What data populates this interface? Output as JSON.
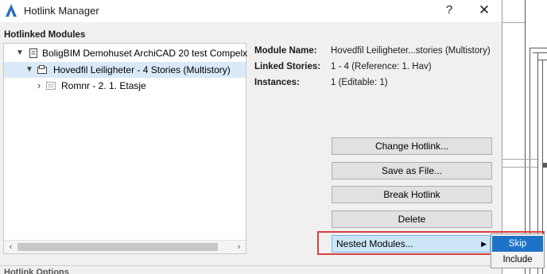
{
  "window": {
    "title": "Hotlink Manager",
    "help_glyph": "?",
    "close_glyph": "✕"
  },
  "section": {
    "title": "Hotlinked Modules"
  },
  "tree": {
    "items": [
      {
        "label": "BoligBIM Demohuset ArchiCAD 20 test Compelx",
        "expander": "▼",
        "icon": "project-file-icon",
        "selected": false
      },
      {
        "label": "Hovedfil Leiligheter - 4 Stories (Multistory)",
        "expander": "▼",
        "icon": "hotlink-module-icon",
        "selected": true
      },
      {
        "label": "Romnr - 2. 1. Etasje",
        "expander": "›",
        "icon": "hotlink-module-dashed-icon",
        "selected": false
      }
    ],
    "scroll_left": "‹",
    "scroll_right": "›"
  },
  "info": {
    "module_name_label": "Module Name:",
    "module_name_value": "Hovedfil Leiligheter...stories (Multistory)",
    "linked_stories_label": "Linked Stories:",
    "linked_stories_value": "1 - 4 (Reference: 1. Hav)",
    "instances_label": "Instances:",
    "instances_value": "1 (Editable: 1)"
  },
  "buttons": {
    "change_hotlink": "Change Hotlink...",
    "save_as_file": "Save as File...",
    "break_hotlink": "Break Hotlink",
    "delete": "Delete",
    "nested_modules": "Nested Modules...",
    "nested_arrow": "▶"
  },
  "submenu": {
    "options": [
      "Skip",
      "Include"
    ],
    "selected": "Skip"
  },
  "bottom": {
    "clipped_label": "Hotlink Options"
  },
  "colors": {
    "selection": "#d9e9f8",
    "menu_highlight": "#1e73c8",
    "annotation_box": "#d94040"
  }
}
